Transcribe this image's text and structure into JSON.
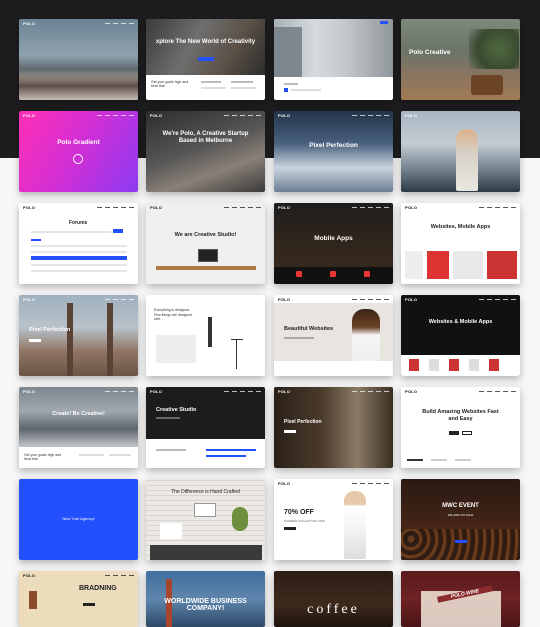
{
  "colors": {
    "page_background": "#f7f7f7",
    "top_band": "#1d1d1f",
    "accent_blue": "#2250fc"
  },
  "cards": [
    {
      "id": "r1c1",
      "logo": "POLO",
      "headline": ""
    },
    {
      "id": "r1c2",
      "logo": "",
      "headline": "xplore The New World of Creativity",
      "caption": "Get your goals high and beat that"
    },
    {
      "id": "r1c3",
      "logo": "",
      "headline": ""
    },
    {
      "id": "r1c4",
      "logo": "",
      "headline": "Polo Creative"
    },
    {
      "id": "r2c1",
      "logo": "POLO",
      "headline": "Polo Gradient"
    },
    {
      "id": "r2c2",
      "logo": "POLO",
      "headline": "We're Polo, A Creative Startup Based in Melburne"
    },
    {
      "id": "r2c3",
      "logo": "POLO",
      "headline": "Pixel Perfection"
    },
    {
      "id": "r2c4",
      "logo": "POLO",
      "headline": ""
    },
    {
      "id": "r3c1",
      "logo": "POLO",
      "headline": "Forums"
    },
    {
      "id": "r3c2",
      "logo": "POLO",
      "headline": "We are Creative Studio!"
    },
    {
      "id": "r3c3",
      "logo": "POLO",
      "headline": "Mobile Apps"
    },
    {
      "id": "r3c4",
      "logo": "POLO",
      "headline": "Websites, Mobile Apps"
    },
    {
      "id": "r4c1",
      "logo": "POLO",
      "headline": "Pixel Perfection"
    },
    {
      "id": "r4c2",
      "logo": "",
      "headline": "Everything is designed. Few things are designed well."
    },
    {
      "id": "r4c3",
      "logo": "POLO",
      "headline": "Beautiful Websites"
    },
    {
      "id": "r4c4",
      "logo": "POLO",
      "headline": "Websites & Mobile Apps"
    },
    {
      "id": "r5c1",
      "logo": "POLO",
      "headline": "Create! Be Creative!",
      "caption": "Get your goals high and beat that"
    },
    {
      "id": "r5c2",
      "logo": "POLO",
      "headline": "Creative Studio"
    },
    {
      "id": "r5c3",
      "logo": "POLO",
      "headline": "Pixel Perfection"
    },
    {
      "id": "r5c4",
      "logo": "POLO",
      "headline": "Build Amazing Websites Fast and Easy"
    },
    {
      "id": "r6c1",
      "logo": "",
      "headline": "New York Agency!"
    },
    {
      "id": "r6c2",
      "logo": "",
      "headline": "The Difference is Hand Crafted"
    },
    {
      "id": "r6c3",
      "logo": "POLO",
      "headline": "70% OFF",
      "caption": "SUMMER COLLECTION 2016"
    },
    {
      "id": "r6c4",
      "logo": "",
      "headline": "MWC EVENT",
      "caption": "WE ARE ON SALE"
    },
    {
      "id": "r7c1",
      "logo": "POLO",
      "headline": "BRADNING"
    },
    {
      "id": "r7c2",
      "logo": "",
      "headline": "WORLDWIDE BUSINESS COMPANY!"
    },
    {
      "id": "r7c3",
      "logo": "",
      "headline": "coffee"
    },
    {
      "id": "r7c4",
      "logo": "",
      "headline": "POLO WINE"
    }
  ]
}
